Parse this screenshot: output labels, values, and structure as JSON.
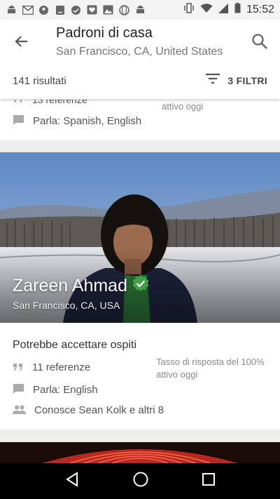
{
  "status_bar": {
    "time": "15:52",
    "left_icons": [
      "android-icon",
      "mail-icon",
      "pin-icon",
      "amazon-icon",
      "settings-icon",
      "heart-icon",
      "photos-icon",
      "globe-icon",
      "android-icon"
    ],
    "right_icons": [
      "vibrate-icon",
      "wifi-icon",
      "signal-icon",
      "battery-icon"
    ]
  },
  "header": {
    "title": "Padroni di casa",
    "subtitle": "San Francisco, CA, United States"
  },
  "results_bar": {
    "count_label": "141 risultati",
    "filters_label": "3 FILTRI"
  },
  "previous_host": {
    "references": "13 referenze",
    "response_partial": "attivo oggi",
    "languages": "Parla: Spanish, English"
  },
  "host": {
    "name": "Zareen Ahmad",
    "location": "San Francisco, CA, USA",
    "verified": true,
    "guest_status": "Potrebbe accettare ospiti",
    "references": "11 referenze",
    "response_line1": "Tasso di risposta del 100%",
    "response_line2": "attivo oggi",
    "languages": "Parla: English",
    "friends": "Conosce Sean Kolk e altri 8"
  },
  "colors": {
    "verified_badge": "#43a047",
    "accent_text": "#444444",
    "secondary_text": "#757575"
  }
}
